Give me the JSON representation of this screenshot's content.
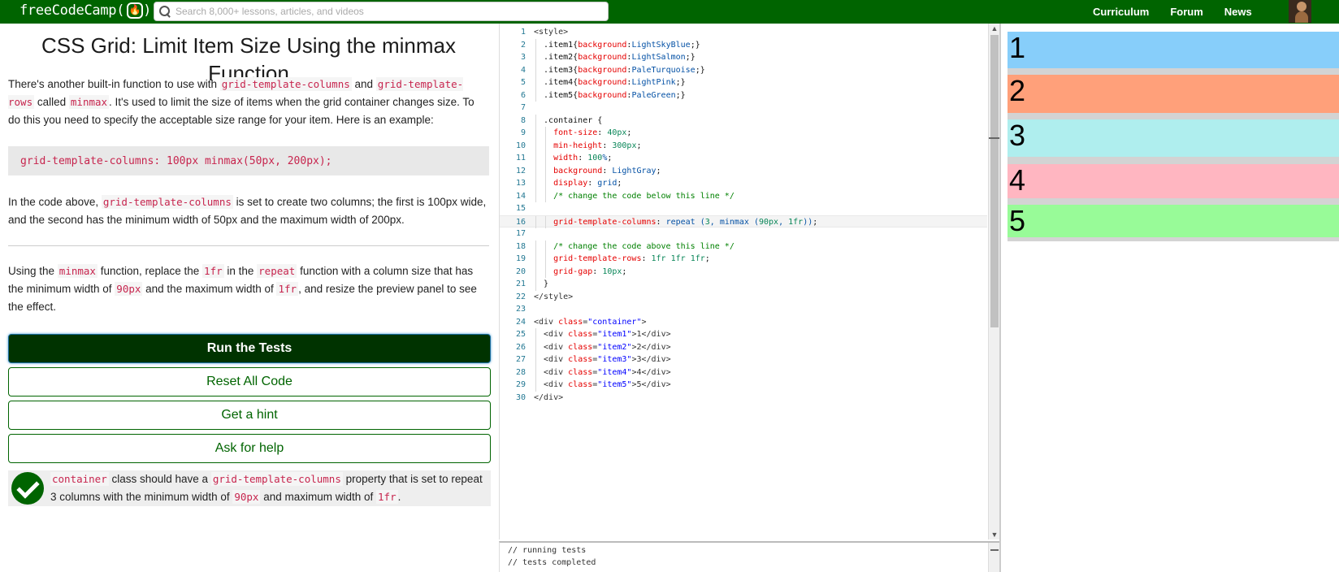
{
  "navbar": {
    "logo_text": "freeCodeCamp(",
    "logo_flame": "🔥",
    "logo_close": ")",
    "search_placeholder": "Search 8,000+ lessons, articles, and videos",
    "links": [
      "Curriculum",
      "Forum",
      "News"
    ]
  },
  "challenge": {
    "title": "CSS Grid: Limit Item Size Using the minmax Function",
    "p1": {
      "t1": "There's another built-in function to use with ",
      "c1": "grid-template-columns",
      "t2": " and ",
      "c2": "grid-template-rows",
      "t3": " called ",
      "c3": "minmax",
      "t4": ". It's used to limit the size of items when the grid container changes size. To do this you need to specify the acceptable size range for your item. Here is an example:"
    },
    "example_code": "grid-template-columns: 100px minmax(50px, 200px);",
    "p2": {
      "t1": "In the code above, ",
      "c1": "grid-template-columns",
      "t2": " is set to create two columns; the first is 100px wide, and the second has the minimum width of 50px and the maximum width of 200px."
    },
    "p3": {
      "t1": "Using the ",
      "c1": "minmax",
      "t2": " function, replace the ",
      "c2": "1fr",
      "t3": " in the ",
      "c3": "repeat",
      "t4": " function with a column size that has the minimum width of ",
      "c4": "90px",
      "t5": " and the maximum width of ",
      "c5": "1fr",
      "t6": ", and resize the preview panel to see the effect."
    }
  },
  "buttons": {
    "run": "Run the Tests",
    "reset": "Reset All Code",
    "hint": "Get a hint",
    "help": "Ask for help"
  },
  "test": {
    "c1": "container",
    "t1": " class should have a ",
    "c2": "grid-template-columns",
    "t2": " property that is set to repeat 3 columns with the minimum width of ",
    "c3": "90px",
    "t3": " and maximum width of ",
    "c4": "1fr",
    "t4": "."
  },
  "editor": {
    "lines": [
      "<style>",
      "  .item1{background:LightSkyBlue;}",
      "  .item2{background:LightSalmon;}",
      "  .item3{background:PaleTurquoise;}",
      "  .item4{background:LightPink;}",
      "  .item5{background:PaleGreen;}",
      "",
      "  .container {",
      "    font-size: 40px;",
      "    min-height: 300px;",
      "    width: 100%;",
      "    background: LightGray;",
      "    display: grid;",
      "    /* change the code below this line */",
      "",
      "    grid-template-columns: repeat (3, minmax (90px, 1fr));",
      "",
      "    /* change the code above this line */",
      "    grid-template-rows: 1fr 1fr 1fr;",
      "    grid-gap: 10px;",
      "  }",
      "</style>",
      "",
      "<div class=\"container\">",
      "  <div class=\"item1\">1</div>",
      "  <div class=\"item2\">2</div>",
      "  <div class=\"item3\">3</div>",
      "  <div class=\"item4\">4</div>",
      "  <div class=\"item5\">5</div>",
      "</div>"
    ],
    "current_line": 16
  },
  "console": {
    "lines": [
      "// running tests",
      "// tests completed"
    ]
  },
  "preview": {
    "items": [
      {
        "label": "1",
        "color": "LightSkyBlue"
      },
      {
        "label": "2",
        "color": "LightSalmon"
      },
      {
        "label": "3",
        "color": "PaleTurquoise"
      },
      {
        "label": "4",
        "color": "LightPink"
      },
      {
        "label": "5",
        "color": "PaleGreen"
      }
    ]
  }
}
